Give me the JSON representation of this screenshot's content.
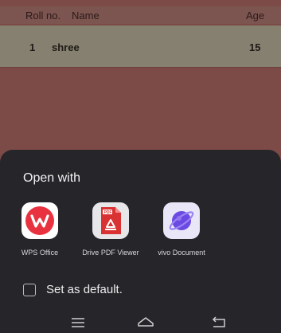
{
  "table": {
    "headers": [
      "Roll no.",
      "Name",
      "Age"
    ],
    "rows": [
      {
        "roll": "1",
        "name": "shree",
        "age": "15"
      }
    ]
  },
  "sheet": {
    "title": "Open with",
    "apps": [
      {
        "label": "WPS Office",
        "icon": "wps-office-icon"
      },
      {
        "label": "Drive PDF Viewer",
        "icon": "drive-pdf-viewer-icon"
      },
      {
        "label": "vivo Document",
        "icon": "vivo-document-icon"
      }
    ],
    "default_label": "Set as default."
  },
  "navbar": {
    "icons": [
      "menu-icon",
      "home-icon",
      "back-icon"
    ]
  },
  "colors": {
    "sheet_bg": "#25252a",
    "wps_red": "#e8323f",
    "pdf_red": "#d93232",
    "vivo_purple": "#6a4ae3"
  }
}
